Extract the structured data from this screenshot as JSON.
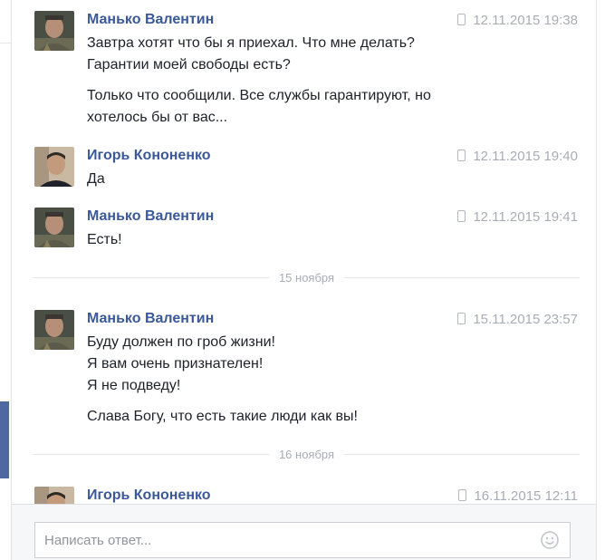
{
  "messages": [
    {
      "author": "Манько Валентин",
      "time": "12.11.2015 19:38",
      "avatar": "manko",
      "paragraphs": [
        [
          "Завтра хотят что бы я приехал. Что мне делать?",
          "Гарантии моей свободы есть?"
        ],
        [
          "Только что сообщили. Все службы гарантируют, но",
          "хотелось бы от вас..."
        ]
      ]
    },
    {
      "author": "Игорь Кононенко",
      "time": "12.11.2015 19:40",
      "avatar": "kononenko",
      "paragraphs": [
        [
          "Да"
        ]
      ]
    },
    {
      "author": "Манько Валентин",
      "time": "12.11.2015 19:41",
      "avatar": "manko",
      "paragraphs": [
        [
          "Есть!"
        ]
      ]
    },
    {
      "author": "Манько Валентин",
      "time": "15.11.2015 23:57",
      "avatar": "manko",
      "paragraphs": [
        [
          "Буду должен по гроб жизни!",
          "Я вам очень признателен!",
          "Я не подведу!"
        ],
        [
          "Слава Богу, что есть такие люди как вы!"
        ]
      ]
    },
    {
      "author": "Игорь Кононенко",
      "time": "16.11.2015 12:11",
      "avatar": "kononenko",
      "paragraphs": []
    }
  ],
  "dividers": [
    "15 ноября",
    "16 ноября"
  ],
  "composer": {
    "placeholder": "Написать ответ...",
    "emoji_icon": "smiley-icon"
  },
  "colors": {
    "author": "#3b5998",
    "timestamp": "#a8adb5",
    "text": "#1d2129",
    "accent_tab": "#4e69a2"
  },
  "icons": {
    "device": "phone-icon",
    "emoji": "smiley-icon"
  }
}
